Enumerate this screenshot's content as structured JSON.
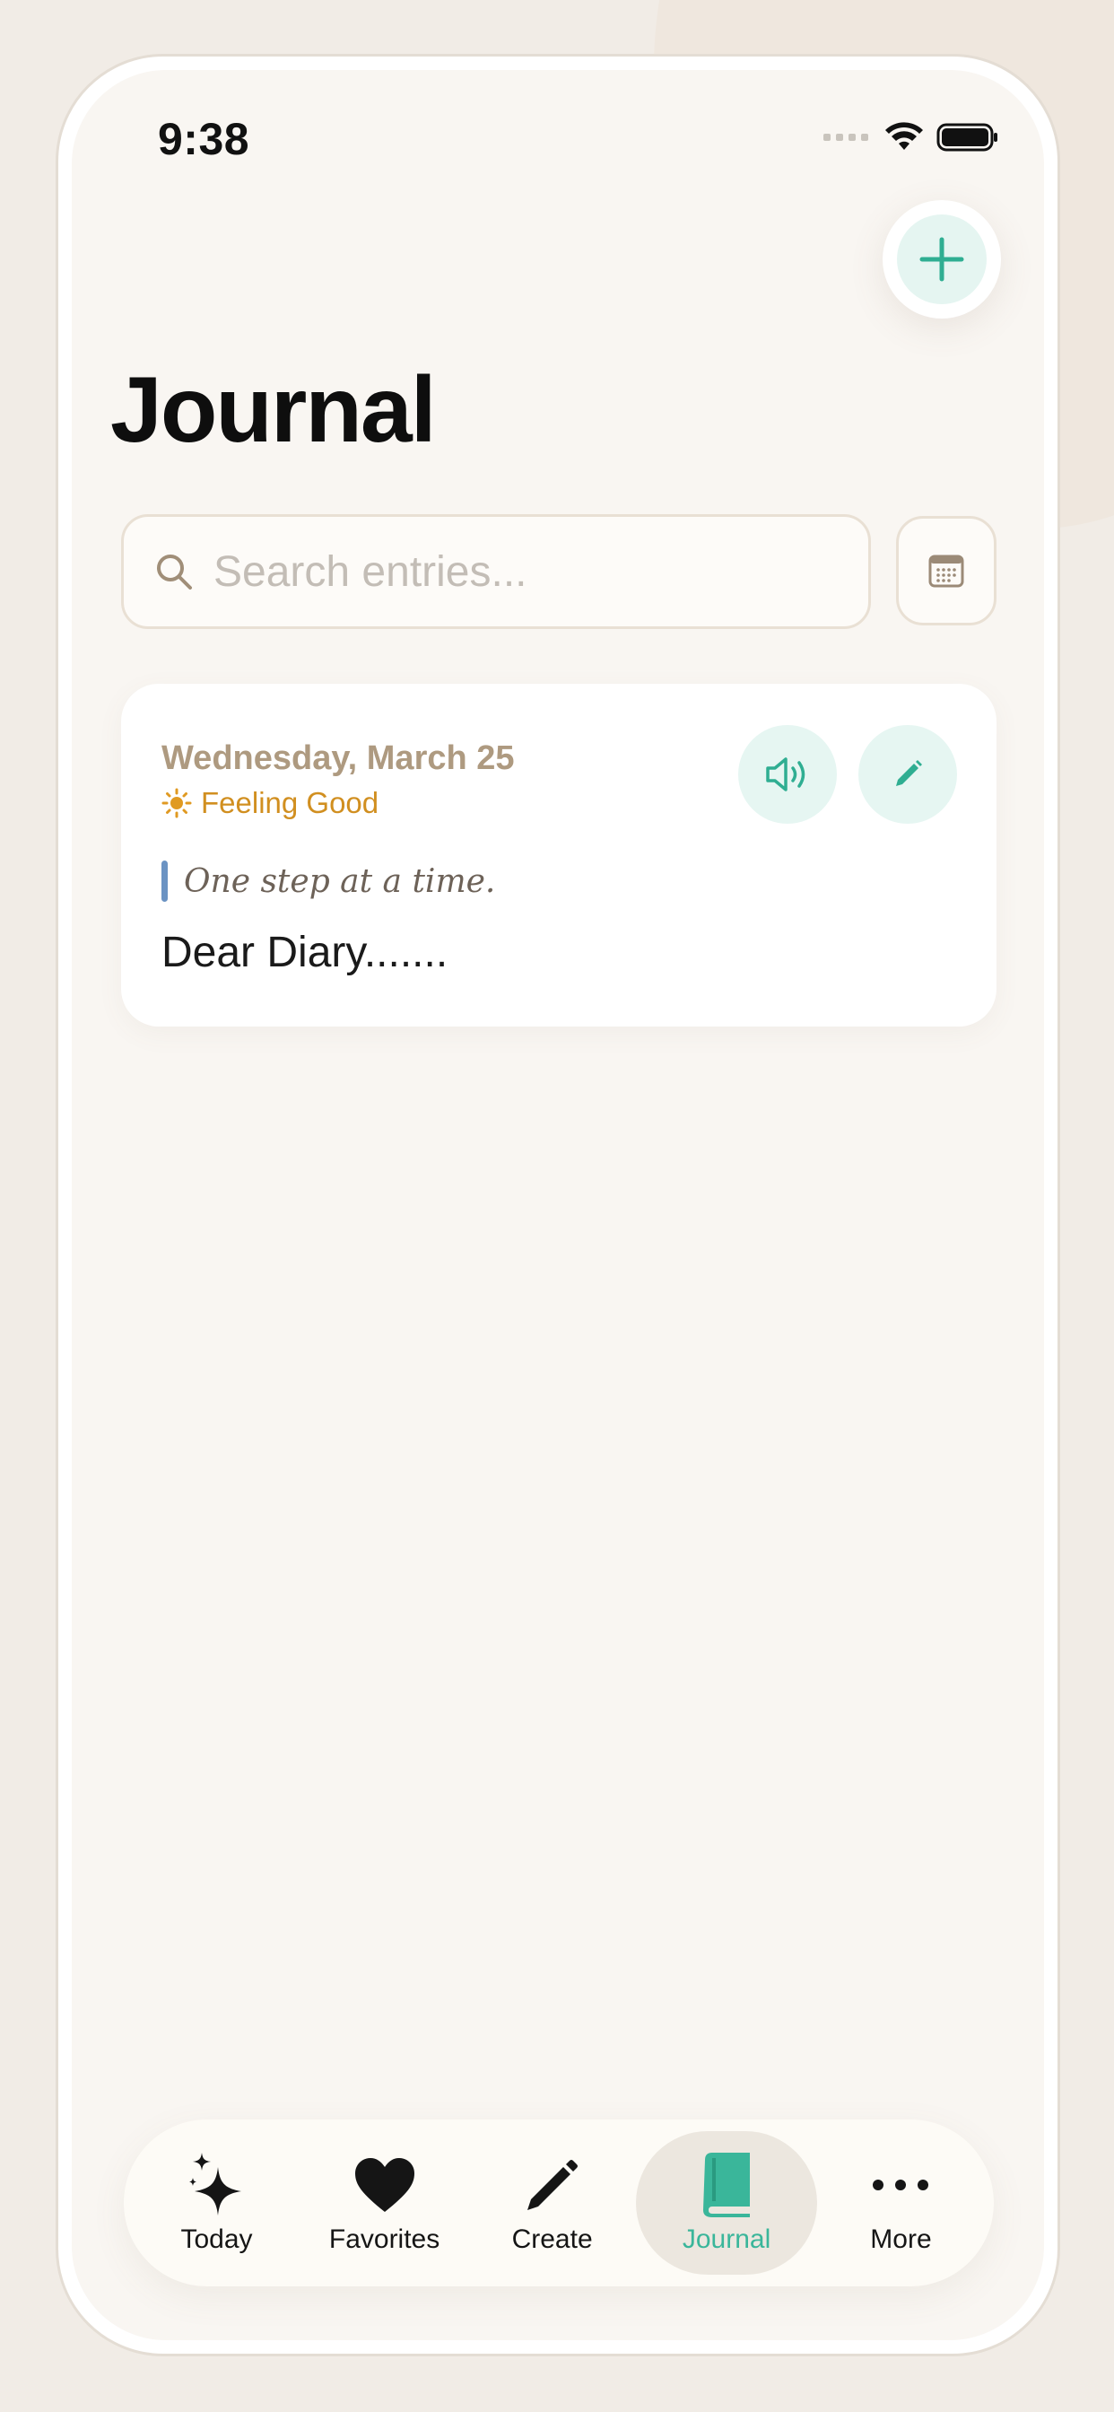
{
  "status_bar": {
    "time": "9:38"
  },
  "header": {
    "title": "Journal",
    "add_icon": "plus-icon"
  },
  "search": {
    "placeholder": "Search entries...",
    "value": ""
  },
  "entries": [
    {
      "date": "Wednesday, March 25",
      "mood_icon": "sun-icon",
      "mood": "Feeling Good",
      "quote": "One step at a time.",
      "body": "Dear Diary......."
    }
  ],
  "tab_bar": {
    "items": [
      {
        "label": "Today",
        "icon": "sparkles-icon",
        "active": false
      },
      {
        "label": "Favorites",
        "icon": "heart-icon",
        "active": false
      },
      {
        "label": "Create",
        "icon": "pencil-icon",
        "active": false
      },
      {
        "label": "Journal",
        "icon": "book-icon",
        "active": true
      },
      {
        "label": "More",
        "icon": "ellipsis-icon",
        "active": false
      }
    ]
  },
  "colors": {
    "accent": "#3ab69a",
    "accent_soft": "#e5f5f1",
    "date_text": "#ae9a80",
    "mood_text": "#d18f20",
    "quote_bar": "#6b93c3",
    "background": "#f9f6f2"
  }
}
